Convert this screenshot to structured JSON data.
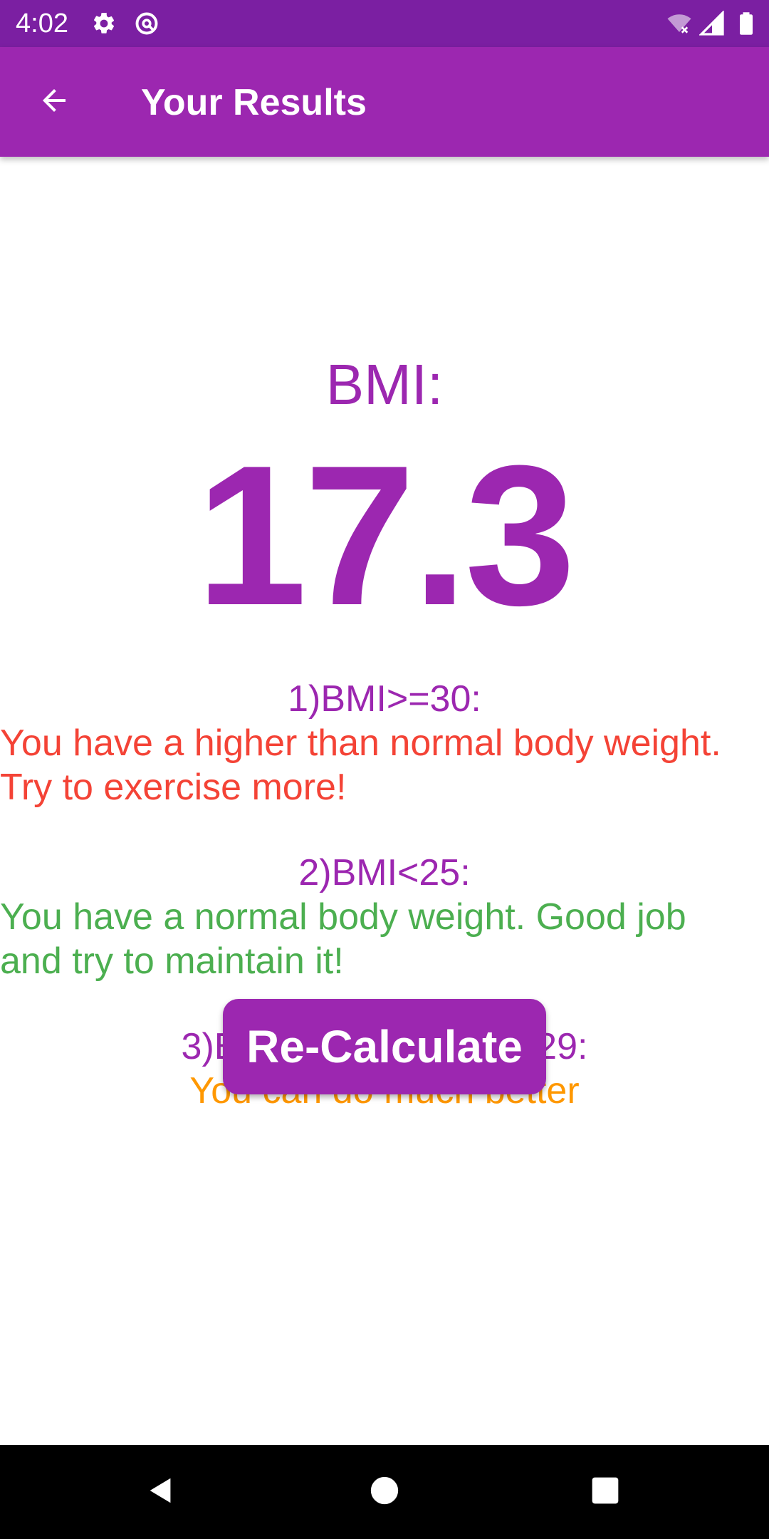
{
  "status_bar": {
    "time": "4:02",
    "left_icons": [
      "gear-icon",
      "do-not-disturb-icon"
    ],
    "right_icons": [
      "wifi-off-icon",
      "signal-icon",
      "battery-icon"
    ]
  },
  "app_bar": {
    "back_icon": "arrow-back-icon",
    "title": "Your Results"
  },
  "result": {
    "label": "BMI:",
    "value": "17.3"
  },
  "rules": [
    {
      "heading": "1)BMI>=30:",
      "lines": [
        "You have a higher than normal body weight.",
        "Try to exercise more!"
      ],
      "color": "#f44336"
    },
    {
      "heading": "2)BMI<25:",
      "lines": [
        "You have a normal  body weight. Good job",
        "and try to maintain it!"
      ],
      "color": "#4caf50"
    },
    {
      "heading": "3)BMI>25 And BMI<=29:",
      "lines": [
        "You can do much better"
      ],
      "color": "#ff9800"
    }
  ],
  "actions": {
    "recalculate_label": "Re-Calculate"
  },
  "nav_bar": {
    "icons": [
      "back-triangle-icon",
      "home-circle-icon",
      "recents-square-icon"
    ]
  },
  "colors": {
    "status_bar": "#7b1fa2",
    "primary": "#9c27b0",
    "nav_bar": "#000000"
  }
}
